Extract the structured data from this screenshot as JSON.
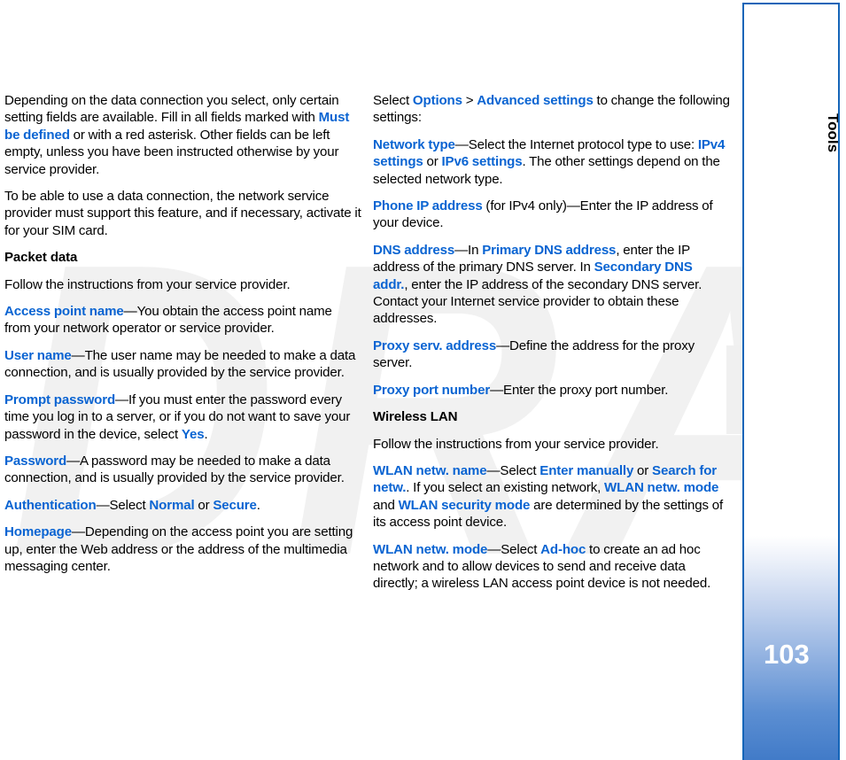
{
  "watermark": {
    "text": "DRAFT"
  },
  "sidebar": {
    "tab_label": "Tools",
    "page_number": "103",
    "border_color": "#1565b8",
    "gradient_end_color": "#3f79c7"
  },
  "accent_color": "#0a64d2",
  "left_column": {
    "paragraphs": [
      {
        "id": "p1",
        "runs": [
          {
            "t": "Depending on the data connection you select, only certain setting fields are available. Fill in all fields marked with ",
            "k": false
          },
          {
            "t": "Must be defined",
            "k": true
          },
          {
            "t": " or with a red asterisk. Other fields can be left empty, unless you have been instructed otherwise by your service provider.",
            "k": false
          }
        ]
      },
      {
        "id": "p2",
        "runs": [
          {
            "t": "To be able to use a data connection, the network service provider must support this feature, and if necessary, activate it for your SIM card.",
            "k": false
          }
        ]
      }
    ],
    "subhead": "Packet data",
    "paragraphs_after": [
      {
        "id": "p3",
        "runs": [
          {
            "t": "Follow the instructions from your service provider.",
            "k": false
          }
        ]
      },
      {
        "id": "p4",
        "runs": [
          {
            "t": "Access point name",
            "k": true
          },
          {
            "t": "—You obtain the access point name from your network operator or service provider.",
            "k": false
          }
        ]
      },
      {
        "id": "p5",
        "runs": [
          {
            "t": "User name",
            "k": true
          },
          {
            "t": "—The user name may be needed to make a data connection, and is usually provided by the service provider.",
            "k": false
          }
        ]
      },
      {
        "id": "p6",
        "runs": [
          {
            "t": "Prompt password",
            "k": true
          },
          {
            "t": "—If you must enter the password every time you log in to a server, or if you do not want to save your password in the device, select ",
            "k": false
          },
          {
            "t": "Yes",
            "k": true
          },
          {
            "t": ".",
            "k": false
          }
        ]
      },
      {
        "id": "p7",
        "runs": [
          {
            "t": "Password",
            "k": true
          },
          {
            "t": "—A password may be needed to make a data connection, and is usually provided by the service provider.",
            "k": false
          }
        ]
      },
      {
        "id": "p8",
        "runs": [
          {
            "t": "Authentication",
            "k": true
          },
          {
            "t": "—Select ",
            "k": false
          },
          {
            "t": "Normal",
            "k": true
          },
          {
            "t": " or ",
            "k": false
          },
          {
            "t": "Secure",
            "k": true
          },
          {
            "t": ".",
            "k": false
          }
        ]
      },
      {
        "id": "p9",
        "runs": [
          {
            "t": "Homepage",
            "k": true
          },
          {
            "t": "—Depending on the access point you are setting up, enter the Web address or the address of the multimedia messaging center.",
            "k": false
          }
        ]
      }
    ]
  },
  "right_column": {
    "paragraphs": [
      {
        "id": "r1",
        "runs": [
          {
            "t": "Select ",
            "k": false
          },
          {
            "t": "Options",
            "k": true
          },
          {
            "t": " > ",
            "k": false
          },
          {
            "t": "Advanced settings",
            "k": true
          },
          {
            "t": " to change the following settings:",
            "k": false
          }
        ]
      },
      {
        "id": "r2",
        "runs": [
          {
            "t": "Network type",
            "k": true
          },
          {
            "t": "—Select the Internet protocol type to use: ",
            "k": false
          },
          {
            "t": "IPv4 settings",
            "k": true
          },
          {
            "t": " or ",
            "k": false
          },
          {
            "t": "IPv6 settings",
            "k": true
          },
          {
            "t": ". The other settings depend on the selected network type.",
            "k": false
          }
        ]
      },
      {
        "id": "r3",
        "runs": [
          {
            "t": "Phone IP address",
            "k": true
          },
          {
            "t": " (for IPv4 only)—Enter the IP address of your device.",
            "k": false
          }
        ]
      },
      {
        "id": "r4",
        "runs": [
          {
            "t": "DNS address",
            "k": true
          },
          {
            "t": "—In ",
            "k": false
          },
          {
            "t": "Primary DNS address",
            "k": true
          },
          {
            "t": ", enter the IP address of the primary DNS server. In ",
            "k": false
          },
          {
            "t": "Secondary DNS addr.",
            "k": true
          },
          {
            "t": ", enter the IP address of the secondary DNS server. Contact your Internet service provider to obtain these addresses.",
            "k": false
          }
        ]
      },
      {
        "id": "r5",
        "runs": [
          {
            "t": "Proxy serv. address",
            "k": true
          },
          {
            "t": "—Define the address for the proxy server.",
            "k": false
          }
        ]
      },
      {
        "id": "r6",
        "runs": [
          {
            "t": "Proxy port number",
            "k": true
          },
          {
            "t": "—Enter the proxy port number.",
            "k": false
          }
        ]
      }
    ],
    "subhead": "Wireless LAN",
    "paragraphs_after": [
      {
        "id": "r7",
        "runs": [
          {
            "t": "Follow the instructions from your service provider.",
            "k": false
          }
        ]
      },
      {
        "id": "r8",
        "runs": [
          {
            "t": "WLAN netw. name",
            "k": true
          },
          {
            "t": "—Select ",
            "k": false
          },
          {
            "t": "Enter manually",
            "k": true
          },
          {
            "t": " or ",
            "k": false
          },
          {
            "t": "Search for netw.",
            "k": true
          },
          {
            "t": ". If you select an existing network, ",
            "k": false
          },
          {
            "t": "WLAN netw. mode",
            "k": true
          },
          {
            "t": " and ",
            "k": false
          },
          {
            "t": "WLAN security mode",
            "k": true
          },
          {
            "t": " are determined by the settings of its access point device.",
            "k": false
          }
        ]
      },
      {
        "id": "r9",
        "runs": [
          {
            "t": "WLAN netw. mode",
            "k": true
          },
          {
            "t": "—Select ",
            "k": false
          },
          {
            "t": "Ad-hoc",
            "k": true
          },
          {
            "t": " to create an ad hoc network and to allow devices to send and receive data directly; a wireless LAN access point device is not needed.",
            "k": false
          }
        ]
      }
    ]
  }
}
